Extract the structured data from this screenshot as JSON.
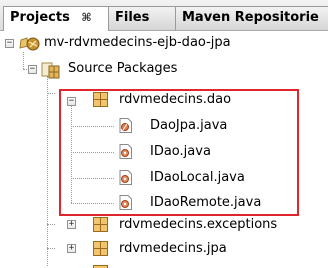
{
  "tabs": [
    {
      "label": "Projects",
      "active": true,
      "close_glyph": "⌘"
    },
    {
      "label": "Files",
      "active": false
    },
    {
      "label": "Maven Repositorie",
      "active": false
    }
  ],
  "tree": {
    "project": {
      "label": "mv-rdvmedecins-ejb-dao-jpa",
      "icon": "maven-project-icon",
      "expanded": true
    },
    "source_packages": {
      "label": "Source Packages",
      "icon": "source-packages-icon",
      "expanded": true
    },
    "packages": [
      {
        "label": "rdvmedecins.dao",
        "icon": "package-icon",
        "expanded": true,
        "files": [
          {
            "label": "DaoJpa.java",
            "icon": "java-class-icon"
          },
          {
            "label": "IDao.java",
            "icon": "java-interface-icon"
          },
          {
            "label": "IDaoLocal.java",
            "icon": "java-interface-icon"
          },
          {
            "label": "IDaoRemote.java",
            "icon": "java-interface-icon"
          }
        ]
      },
      {
        "label": "rdvmedecins.exceptions",
        "icon": "package-icon",
        "expanded": false
      },
      {
        "label": "rdvmedecins.jpa",
        "icon": "package-icon",
        "expanded": false
      }
    ],
    "expander_collapsed": "+",
    "expander_expanded": "−"
  },
  "colors": {
    "highlight_border": "#e0262a",
    "package_icon": "#d9a441",
    "java_file_accent": "#c0392b",
    "tab_active_bg": "#ffffff"
  }
}
